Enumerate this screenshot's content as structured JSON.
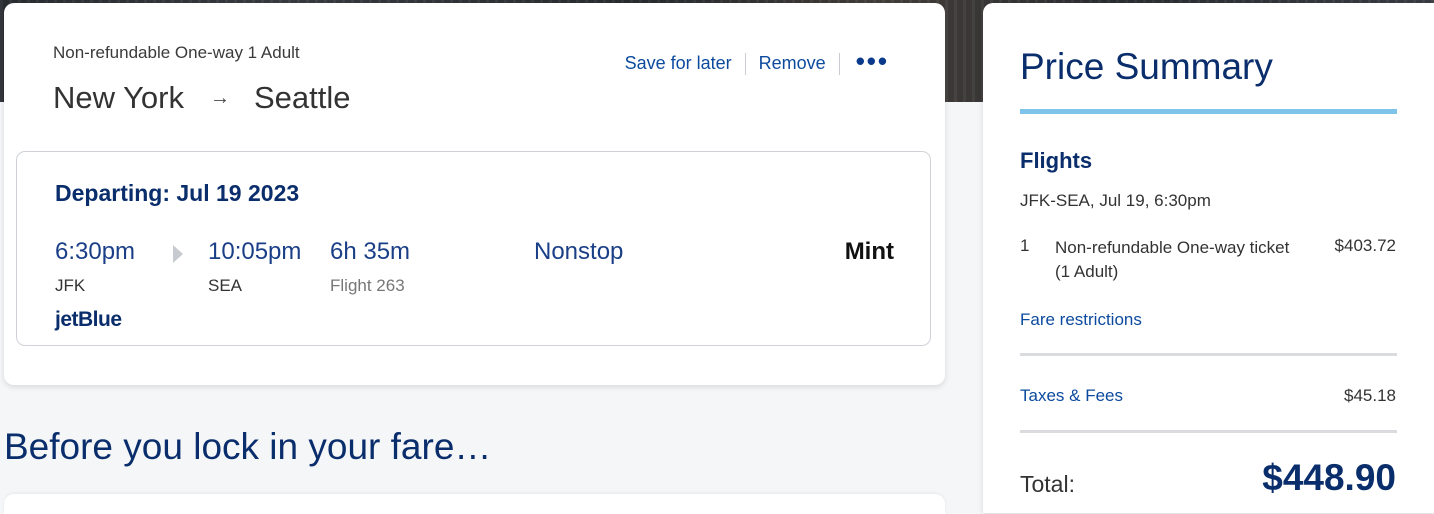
{
  "trip": {
    "meta": "Non-refundable One-way 1 Adult",
    "origin": "New York",
    "arrow": "→",
    "destination": "Seattle",
    "actions": {
      "save_for_later": "Save for later",
      "remove": "Remove",
      "more": "•••"
    },
    "segment": {
      "departing": "Departing: Jul 19 2023",
      "depart_time": "6:30pm",
      "arrive_time": "10:05pm",
      "duration": "6h 35m",
      "stops": "Nonstop",
      "cabin": "Mint",
      "origin_code": "JFK",
      "destination_code": "SEA",
      "flight": "Flight 263",
      "airline": "jetBlue"
    }
  },
  "before_heading": "Before you lock in your fare…",
  "summary": {
    "title": "Price Summary",
    "flights_heading": "Flights",
    "flight_detail": "JFK-SEA, Jul 19, 6:30pm",
    "line_item": {
      "qty": "1",
      "description": "Non-refundable One-way ticket (1 Adult)",
      "price": "$403.72"
    },
    "fare_restrictions": "Fare restrictions",
    "taxes_label": "Taxes & Fees",
    "taxes_price": "$45.18",
    "total_label": "Total:",
    "total_price": "$448.90"
  },
  "colors": {
    "brand_navy": "#0a2d6b",
    "link_blue": "#0b4a9e",
    "accent_light_blue": "#7ec3ea"
  },
  "icons": {
    "route_arrow": "arrow-right-icon",
    "more": "more-options-icon",
    "segment_separator": "play-icon"
  }
}
